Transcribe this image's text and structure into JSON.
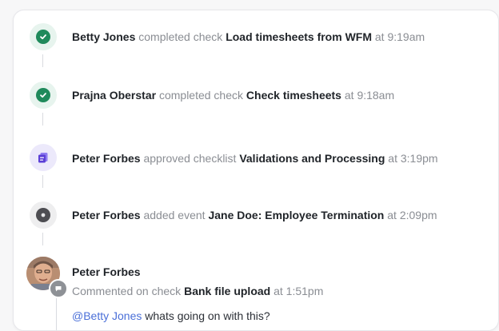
{
  "activity": [
    {
      "actor": "Betty Jones",
      "action": "completed check",
      "target": "Load timesheets from WFM",
      "time_prefix": "at",
      "time": "9:19am",
      "icon": "check-circle-icon"
    },
    {
      "actor": "Prajna Oberstar",
      "action": "completed check",
      "target": "Check timesheets",
      "time_prefix": "at",
      "time": "9:18am",
      "icon": "check-circle-icon"
    },
    {
      "actor": "Peter Forbes",
      "action": "approved checklist",
      "target": "Validations and Processing",
      "time_prefix": "at",
      "time": "3:19pm",
      "icon": "checklist-icon"
    },
    {
      "actor": "Peter Forbes",
      "action": "added event",
      "target": "Jane Doe: Employee Termination",
      "time_prefix": "at",
      "time": "2:09pm",
      "icon": "event-icon"
    }
  ],
  "comment": {
    "author": "Peter Forbes",
    "action": "Commented on check",
    "target": "Bank file upload",
    "time_prefix": "at",
    "time": "1:51pm",
    "mention": "@Betty Jones",
    "message": "whats going on with this?",
    "icon": "comment-icon"
  },
  "colors": {
    "success": "#1f8a5b",
    "checklist": "#5b3fd6",
    "event": "#4d4d52",
    "mention": "#4a6fd8"
  }
}
